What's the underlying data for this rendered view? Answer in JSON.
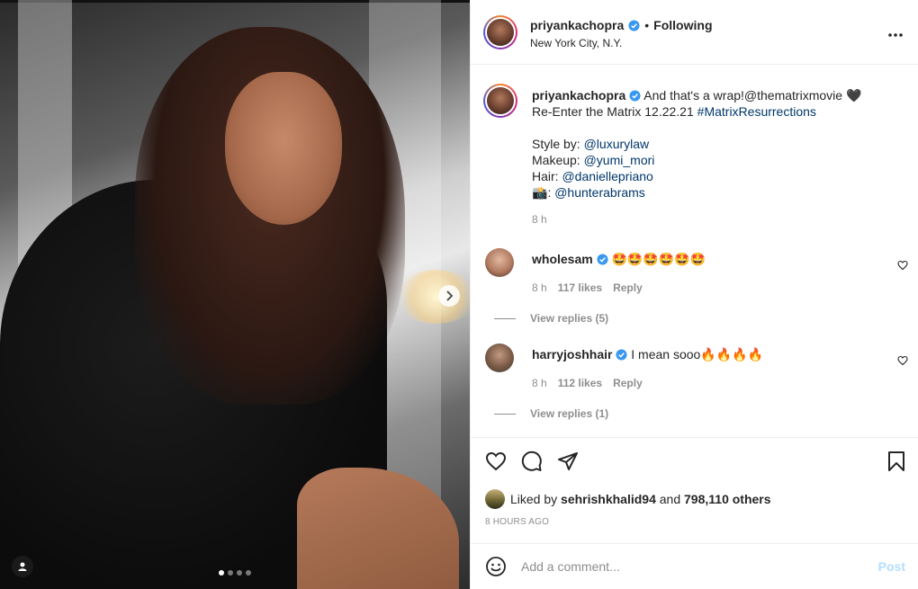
{
  "post": {
    "author": "priyankachopra",
    "separator": "•",
    "follow_state": "Following",
    "location": "New York City, N.Y.",
    "carousel": {
      "total": 4,
      "current": 1
    }
  },
  "caption": {
    "username": "priyankachopra",
    "line1_text": "And that's a wrap!",
    "line1_mention": "@thematrixmovie",
    "line1_emoji": "🖤",
    "line2_text": "Re-Enter the Matrix 12.22.21 ",
    "line2_hashtag": "#MatrixResurrections",
    "style_label": "Style by: ",
    "style_mention": "@luxurylaw",
    "makeup_label": "Makeup: ",
    "makeup_mention": "@yumi_mori",
    "hair_label": "Hair: ",
    "hair_mention": "@daniellepriano",
    "photo_emoji": "📸",
    "photo_mention": "@hunterabrams",
    "time": "8 h"
  },
  "comments": [
    {
      "username": "wholesam",
      "text": "🤩🤩🤩🤩🤩🤩",
      "time": "8 h",
      "likes": "117 likes",
      "reply": "Reply",
      "view_replies": "View replies (5)"
    },
    {
      "username": "harryjoshhair",
      "text": "I mean sooo🔥🔥🔥🔥",
      "time": "8 h",
      "likes": "112 likes",
      "reply": "Reply",
      "view_replies": "View replies (1)"
    }
  ],
  "likes": {
    "prefix": "Liked by ",
    "user": "sehrishkhalid94",
    "middle": " and ",
    "others": "798,110 others"
  },
  "posted": "8 HOURS AGO",
  "add_comment": {
    "placeholder": "Add a comment...",
    "post_label": "Post"
  },
  "colors": {
    "verified": "#3897f0",
    "link": "#00376b",
    "muted": "#8e8e8e",
    "post_disabled": "#b2dffc"
  }
}
